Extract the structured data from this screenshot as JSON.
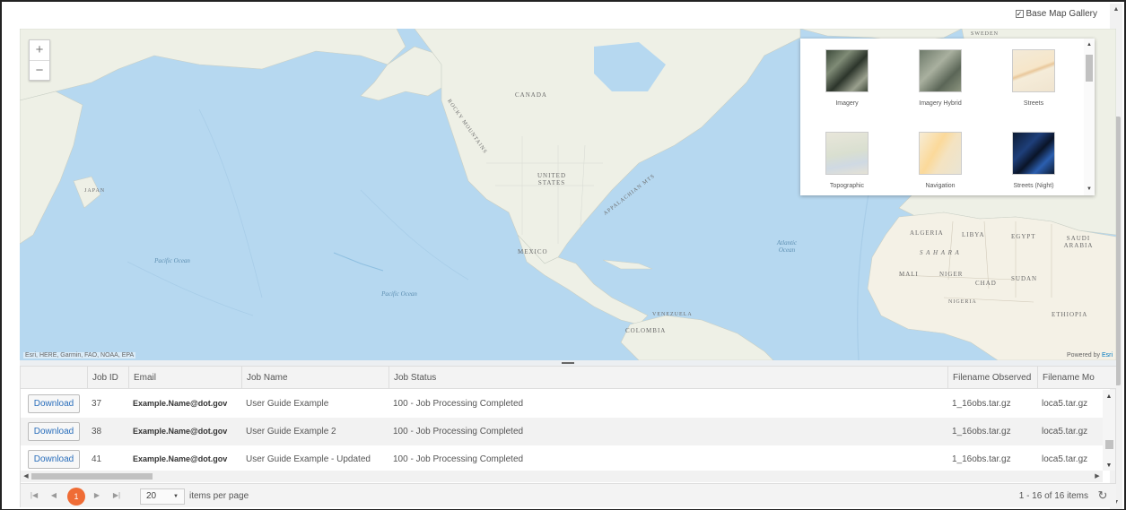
{
  "gallery_toggle": {
    "label": "Base Map Gallery",
    "checked": true
  },
  "map": {
    "zoom_in": "+",
    "zoom_out": "−",
    "attribution": "Esri, HERE, Garmin, FAO, NOAA, EPA",
    "powered_by_prefix": "Powered by ",
    "powered_by_brand": "Esri",
    "labels": {
      "canada": "CANADA",
      "united_states": "UNITED STATES",
      "mexico": "MEXICO",
      "rocky": "ROCKY MOUNTAINS",
      "appalachian": "APPALACHIAN MTS",
      "pacific1": "Pacific Ocean",
      "pacific2": "Pacific Ocean",
      "atlantic": "Atlantic Ocean",
      "algeria": "ALGERIA",
      "libya": "LIBYA",
      "egypt": "EGYPT",
      "saudi": "SAUDI ARABIA",
      "sahara": "S A H A R A",
      "mali": "MALI",
      "niger": "NIGER",
      "chad": "CHAD",
      "sudan": "SUDAN",
      "nigeria": "NIGERIA",
      "ethiopia": "ETHIOPIA",
      "colombia": "COLOMBIA",
      "venezuela": "VENEZUELA",
      "japan": "JAPAN",
      "sweden": "SWEDEN"
    }
  },
  "gallery": {
    "items": [
      {
        "label": "Imagery",
        "icon": "imagery-thumb"
      },
      {
        "label": "Imagery Hybrid",
        "icon": "imagery-hybrid-thumb"
      },
      {
        "label": "Streets",
        "icon": "streets-thumb"
      },
      {
        "label": "Topographic",
        "icon": "topographic-thumb"
      },
      {
        "label": "Navigation",
        "icon": "navigation-thumb"
      },
      {
        "label": "Streets (Night)",
        "icon": "streets-night-thumb"
      }
    ]
  },
  "grid": {
    "columns": [
      "",
      "Job ID",
      "Email",
      "Job Name",
      "Job Status",
      "Filename Observed",
      "Filename Mo"
    ],
    "download_label": "Download",
    "rows": [
      {
        "job_id": "37",
        "email": "Example.Name@dot.gov",
        "job_name": "User Guide Example",
        "status": "100 - Job Processing Completed",
        "observed": "1_16obs.tar.gz",
        "model": "loca5.tar.gz"
      },
      {
        "job_id": "38",
        "email": "Example.Name@dot.gov",
        "job_name": "User Guide Example 2",
        "status": "100 - Job Processing Completed",
        "observed": "1_16obs.tar.gz",
        "model": "loca5.tar.gz"
      },
      {
        "job_id": "41",
        "email": "Example.Name@dot.gov",
        "job_name": "User Guide Example - Updated",
        "status": "100 - Job Processing Completed",
        "observed": "1_16obs.tar.gz",
        "model": "loca5.tar.gz"
      }
    ]
  },
  "pager": {
    "current_page": "1",
    "page_size": "20",
    "items_per_page_label": "items per page",
    "info": "1 - 16 of 16 items"
  },
  "colors": {
    "accent": "#ef6c35",
    "link": "#2a6ebb",
    "ocean": "#b6d8f0"
  }
}
